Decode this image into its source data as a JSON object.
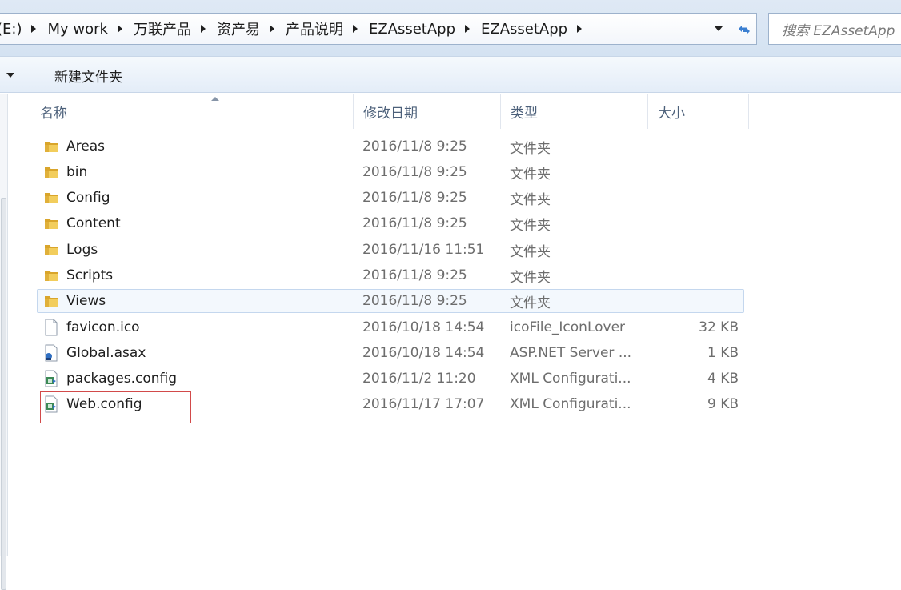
{
  "address_bar": {
    "crumbs": [
      "(E:)",
      "My work",
      "万联产品",
      "资产易",
      "产品说明",
      "EZAssetApp",
      "EZAssetApp"
    ],
    "refresh_icon": "refresh-icon",
    "search_placeholder": "搜索 EZAssetApp"
  },
  "toolbar": {
    "new_folder_label": "新建文件夹"
  },
  "columns": {
    "name": "名称",
    "date": "修改日期",
    "type": "类型",
    "size": "大小"
  },
  "files": [
    {
      "name": "Areas",
      "date": "2016/11/8 9:25",
      "type": "文件夹",
      "size": "",
      "icon": "folder-icon"
    },
    {
      "name": "bin",
      "date": "2016/11/8 9:25",
      "type": "文件夹",
      "size": "",
      "icon": "folder-icon"
    },
    {
      "name": "Config",
      "date": "2016/11/8 9:25",
      "type": "文件夹",
      "size": "",
      "icon": "folder-icon"
    },
    {
      "name": "Content",
      "date": "2016/11/8 9:25",
      "type": "文件夹",
      "size": "",
      "icon": "folder-icon"
    },
    {
      "name": "Logs",
      "date": "2016/11/16 11:51",
      "type": "文件夹",
      "size": "",
      "icon": "folder-icon"
    },
    {
      "name": "Scripts",
      "date": "2016/11/8 9:25",
      "type": "文件夹",
      "size": "",
      "icon": "folder-icon"
    },
    {
      "name": "Views",
      "date": "2016/11/8 9:25",
      "type": "文件夹",
      "size": "",
      "icon": "folder-icon"
    },
    {
      "name": "favicon.ico",
      "date": "2016/10/18 14:54",
      "type": "icoFile_IconLover",
      "size": "32 KB",
      "icon": "file-icon"
    },
    {
      "name": "Global.asax",
      "date": "2016/10/18 14:54",
      "type": "ASP.NET Server ...",
      "size": "1 KB",
      "icon": "aspnet-file-icon"
    },
    {
      "name": "packages.config",
      "date": "2016/11/2 11:20",
      "type": "XML Configurati...",
      "size": "4 KB",
      "icon": "config-file-icon"
    },
    {
      "name": "Web.config",
      "date": "2016/11/17 17:07",
      "type": "XML Configurati...",
      "size": "9 KB",
      "icon": "config-file-icon"
    }
  ],
  "colors": {
    "highlight_box": "#d24a4a",
    "selected_row": "#f3f8fd",
    "folder": "#e8b93a"
  }
}
